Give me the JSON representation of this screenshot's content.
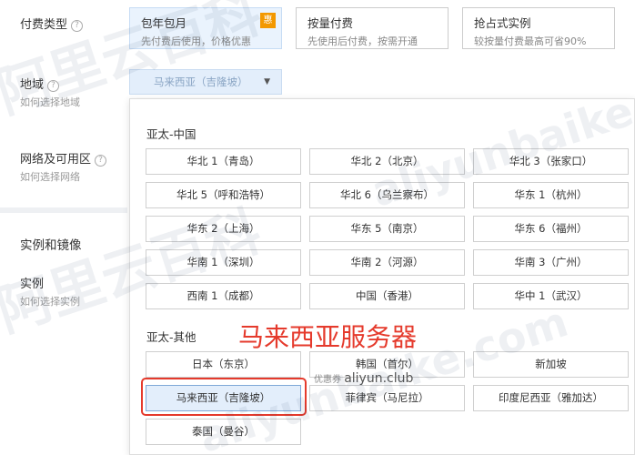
{
  "form": {
    "billing_label": "付费类型",
    "region_label": "地域",
    "region_help": "如何选择地域",
    "network_label": "网络及可用区",
    "network_help": "如何选择网络",
    "instance_section": "实例和镜像",
    "instance_label": "实例",
    "instance_help": "如何选择实例"
  },
  "billing_options": [
    {
      "title": "包年包月",
      "desc": "先付费后使用，价格优惠",
      "badge": "惠"
    },
    {
      "title": "按量付费",
      "desc": "先使用后付费，按需开通"
    },
    {
      "title": "抢占式实例",
      "desc": "较按量付费最高可省90%"
    }
  ],
  "region_select": {
    "value": "马来西亚（吉隆坡）"
  },
  "dropdown": {
    "china_title": "亚太-中国",
    "china_regions": [
      "华北 1（青岛）",
      "华北 2（北京）",
      "华北 3（张家口）",
      "华北 5（呼和浩特）",
      "华北 6（乌兰察布）",
      "华东 1（杭州）",
      "华东 2（上海）",
      "华东 5（南京）",
      "华东 6（福州）",
      "华南 1（深圳）",
      "华南 2（河源）",
      "华南 3（广州）",
      "西南 1（成都）",
      "中国（香港）",
      "华中 1（武汉）"
    ],
    "other_title": "亚太-其他",
    "other_regions": [
      "日本（东京）",
      "韩国（首尔）",
      "新加坡",
      "马来西亚（吉隆坡）",
      "菲律宾（马尼拉）",
      "印度尼西亚（雅加达）",
      "泰国（曼谷）"
    ],
    "selected_index": 3
  },
  "annotation": {
    "text": "马来西亚服务器",
    "promo_prefix": "优惠券",
    "promo_site": "aliyun.club"
  },
  "watermarks": {
    "cn": "阿里云百科",
    "en": "aliyunbaike.com"
  }
}
